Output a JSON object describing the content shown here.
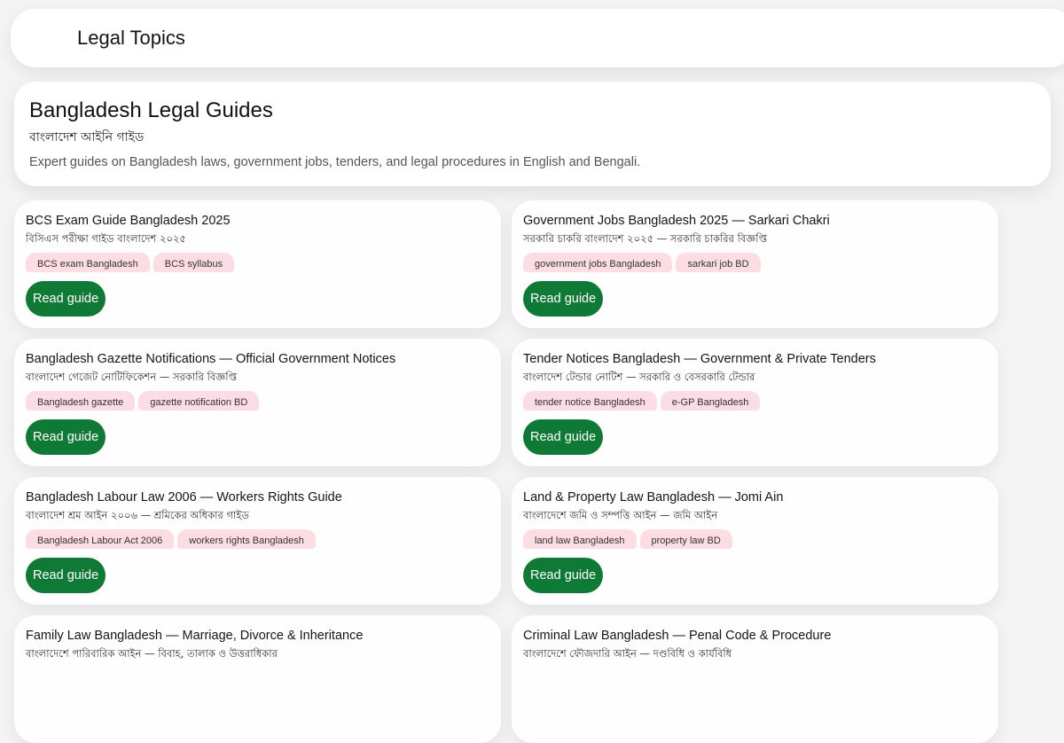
{
  "header": {
    "title": "Legal Topics"
  },
  "hero": {
    "title": "Bangladesh Legal Guides",
    "subtitle": "বাংলাদেশ আইনি গাইড",
    "description": "Expert guides on Bangladesh laws, government jobs, tenders, and legal procedures in English and Bengali."
  },
  "colors": {
    "accent_button": "#0f7a35",
    "tag_background": "#fcdde3",
    "card_background": "#fefefe",
    "page_background": "#f3f4f3"
  },
  "cards": [
    {
      "title": "BCS Exam Guide Bangladesh 2025",
      "subtitle": "বিসিএস পরীক্ষা গাইড বাংলাদেশ ২০২৫",
      "tags": [
        "BCS exam Bangladesh",
        "BCS syllabus"
      ],
      "button": "Read guide"
    },
    {
      "title": "Government Jobs Bangladesh 2025 — Sarkari Chakri",
      "subtitle": "সরকারি চাকরি বাংলাদেশ ২০২৫ — সরকারি চাকরির বিজ্ঞপ্তি",
      "tags": [
        "government jobs Bangladesh",
        "sarkari job BD"
      ],
      "button": "Read guide"
    },
    {
      "title": "Bangladesh Gazette Notifications — Official Government Notices",
      "subtitle": "বাংলাদেশ গেজেট নোটিফিকেশন — সরকারি বিজ্ঞপ্তি",
      "tags": [
        "Bangladesh gazette",
        "gazette notification BD"
      ],
      "button": "Read guide"
    },
    {
      "title": "Tender Notices Bangladesh — Government & Private Tenders",
      "subtitle": "বাংলাদেশ টেন্ডার নোটিশ — সরকারি ও বেসরকারি টেন্ডার",
      "tags": [
        "tender notice Bangladesh",
        "e-GP Bangladesh"
      ],
      "button": "Read guide"
    },
    {
      "title": "Bangladesh Labour Law 2006 — Workers Rights Guide",
      "subtitle": "বাংলাদেশ শ্রম আইন ২০০৬ — শ্রমিকের অধিকার গাইড",
      "tags": [
        "Bangladesh Labour Act 2006",
        "workers rights Bangladesh"
      ],
      "button": "Read guide"
    },
    {
      "title": "Land & Property Law Bangladesh — Jomi Ain",
      "subtitle": "বাংলাদেশে জমি ও সম্পত্তি আইন — জমি আইন",
      "tags": [
        "land law Bangladesh",
        "property law BD"
      ],
      "button": "Read guide"
    },
    {
      "title": "Family Law Bangladesh — Marriage, Divorce & Inheritance",
      "subtitle": "বাংলাদেশে পারিবারিক আইন — বিবাহ, তালাক ও উত্তরাধিকার",
      "tags": [],
      "button": ""
    },
    {
      "title": "Criminal Law Bangladesh — Penal Code & Procedure",
      "subtitle": "বাংলাদেশে ফৌজদারি আইন — দণ্ডবিধি ও কার্যবিধি",
      "tags": [],
      "button": ""
    }
  ]
}
